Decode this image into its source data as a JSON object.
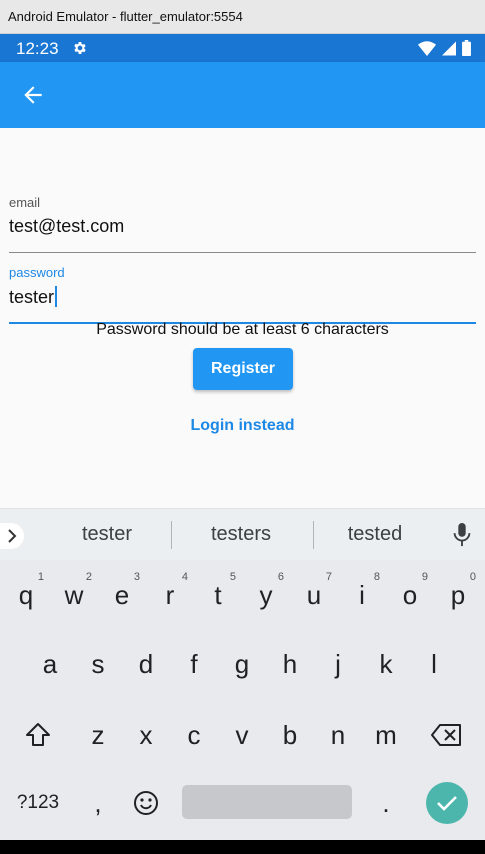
{
  "window": {
    "title": "Android Emulator - flutter_emulator:5554"
  },
  "status_bar": {
    "time": "12:23"
  },
  "form": {
    "email_label": "email",
    "email_value": "test@test.com",
    "password_label": "password",
    "password_value": "tester",
    "error_text": "Password should be at least 6 characters",
    "register_label": "Register",
    "login_instead_label": "Login instead"
  },
  "suggestions": [
    "tester",
    "testers",
    "tested"
  ],
  "keyboard": {
    "row1": [
      {
        "k": "q",
        "n": "1"
      },
      {
        "k": "w",
        "n": "2"
      },
      {
        "k": "e",
        "n": "3"
      },
      {
        "k": "r",
        "n": "4"
      },
      {
        "k": "t",
        "n": "5"
      },
      {
        "k": "y",
        "n": "6"
      },
      {
        "k": "u",
        "n": "7"
      },
      {
        "k": "i",
        "n": "8"
      },
      {
        "k": "o",
        "n": "9"
      },
      {
        "k": "p",
        "n": "0"
      }
    ],
    "row2": [
      "a",
      "s",
      "d",
      "f",
      "g",
      "h",
      "j",
      "k",
      "l"
    ],
    "row3": [
      "z",
      "x",
      "c",
      "v",
      "b",
      "n",
      "m"
    ],
    "symbols_label": "?123",
    "comma": ",",
    "period": "."
  },
  "colors": {
    "status_bar": "#1976d2",
    "app_bar": "#2196f3",
    "accent": "#1e88e5",
    "enter_key": "#4db6ac",
    "keyboard_bg": "#e8eaed"
  },
  "icons": {
    "back": "arrow-left-icon",
    "settings": "gear-icon",
    "wifi": "wifi-icon",
    "signal": "signal-icon",
    "battery": "battery-icon",
    "expand": "chevron-right-icon",
    "mic": "mic-icon",
    "shift": "shift-icon",
    "backspace": "backspace-icon",
    "emoji": "emoji-icon",
    "enter": "check-icon"
  }
}
